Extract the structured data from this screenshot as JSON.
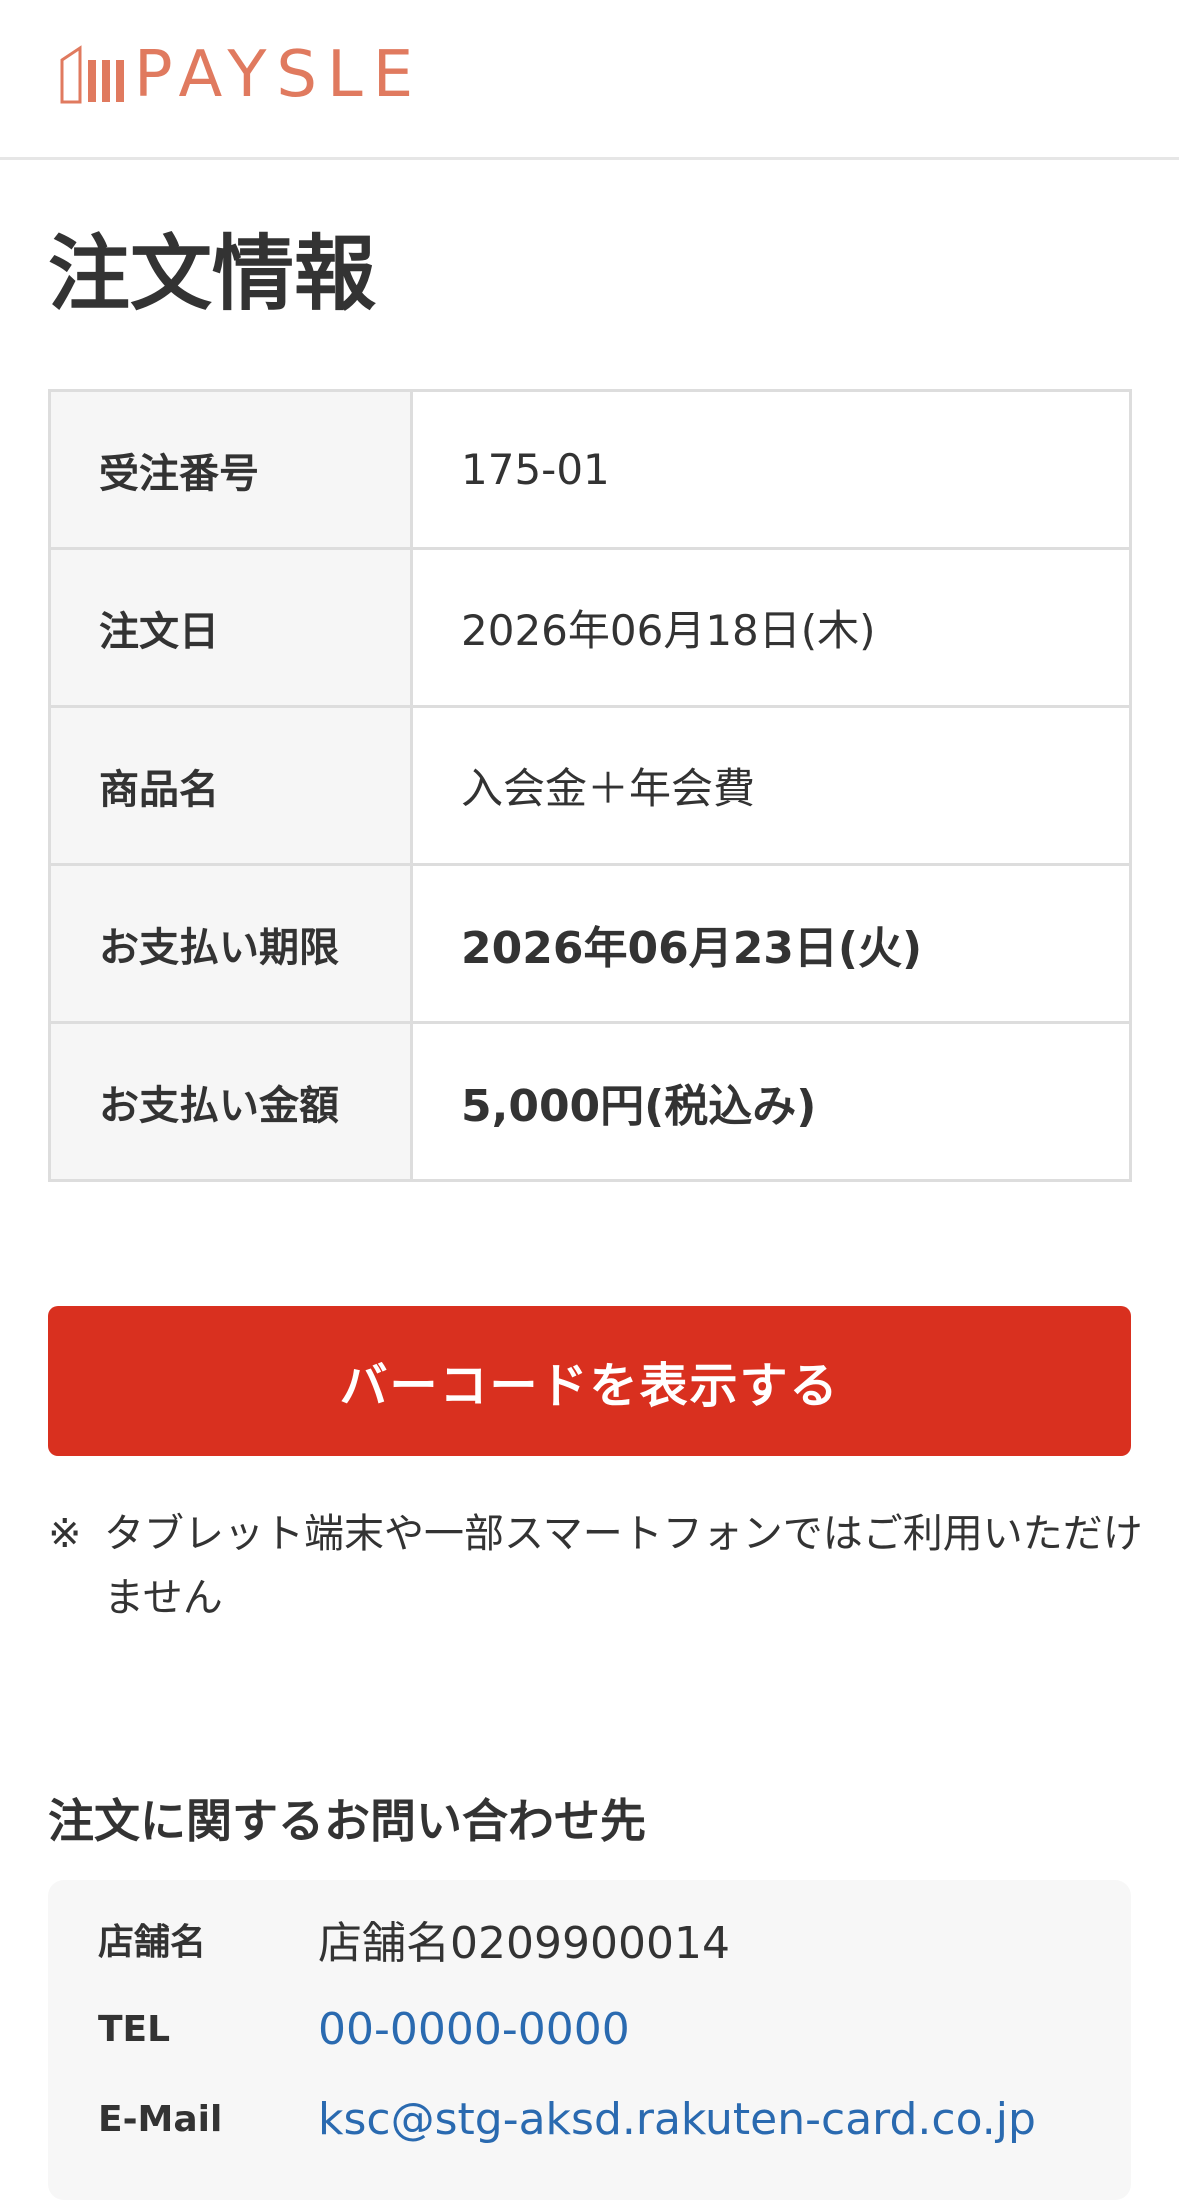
{
  "header": {
    "logo_text": "PAYSLE",
    "brand_color": "#e07a5f"
  },
  "page": {
    "title": "注文情報"
  },
  "order": {
    "rows": [
      {
        "label": "受注番号",
        "value": "175-01"
      },
      {
        "label": "注文日",
        "value": "2026年06月18日(木)"
      },
      {
        "label": "商品名",
        "value": "入会金＋年会費"
      },
      {
        "label": "お支払い期限",
        "value": "2026年06月23日(火)"
      },
      {
        "label": "お支払い金額",
        "value": "5,000円(税込み)"
      }
    ]
  },
  "actions": {
    "barcode_label": "バーコードを表示する",
    "button_color": "#d9301f"
  },
  "note": {
    "mark": "※",
    "text": "タブレット端末や一部スマートフォンではご利用いただけません"
  },
  "contact": {
    "title": "注文に関するお問い合わせ先",
    "store_label": "店舗名",
    "store_value": "店舗名0209900014",
    "tel_label": "TEL",
    "tel_value": "00-0000-0000",
    "email_label": "E-Mail",
    "email_value": "ksc@stg-aksd.rakuten-card.co.jp"
  }
}
